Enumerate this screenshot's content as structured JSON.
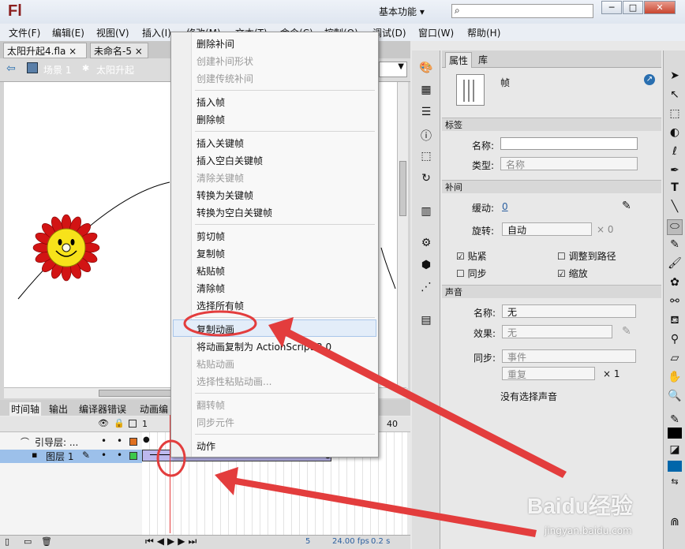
{
  "app": {
    "logo": "Fl",
    "workspace": "基本功能 ▾",
    "search_placeholder": "⌕"
  },
  "menubar": [
    "文件(F)",
    "编辑(E)",
    "视图(V)",
    "插入(I)",
    "修改(M)",
    "文本(T)",
    "命令(C)",
    "控制(O)",
    "调试(D)",
    "窗口(W)",
    "帮助(H)"
  ],
  "doc_tabs": [
    "太阳升起4.fla ×",
    "未命名-5 ×"
  ],
  "breadcrumb": {
    "scene": "场景 1",
    "symbol": "太阳升起"
  },
  "timeline": {
    "tabs": [
      "时间轴",
      "输出",
      "编译器错误",
      "动画编"
    ],
    "frame_marks": {
      "one": "1",
      "forty": "40"
    },
    "layers": [
      {
        "name": "引导层: ..."
      },
      {
        "name": "图层 1"
      }
    ],
    "status": {
      "frame": "5",
      "fps": "24.00 fps",
      "time": "0.2 s"
    }
  },
  "context_menu": {
    "items": [
      {
        "label": "删除补间",
        "disabled": false
      },
      {
        "label": "创建补间形状",
        "disabled": true
      },
      {
        "label": "创建传统补间",
        "disabled": true
      },
      {
        "label": "插入帧",
        "disabled": false
      },
      {
        "label": "删除帧",
        "disabled": false
      },
      {
        "label": "插入关键帧",
        "disabled": false
      },
      {
        "label": "插入空白关键帧",
        "disabled": false
      },
      {
        "label": "清除关键帧",
        "disabled": true
      },
      {
        "label": "转换为关键帧",
        "disabled": false
      },
      {
        "label": "转换为空白关键帧",
        "disabled": false
      },
      {
        "label": "剪切帧",
        "disabled": false
      },
      {
        "label": "复制帧",
        "disabled": false
      },
      {
        "label": "粘贴帧",
        "disabled": false
      },
      {
        "label": "清除帧",
        "disabled": false
      },
      {
        "label": "选择所有帧",
        "disabled": false
      },
      {
        "label": "复制动画",
        "disabled": false
      },
      {
        "label": "将动画复制为 ActionScript 3.0",
        "disabled": false
      },
      {
        "label": "粘贴动画",
        "disabled": true
      },
      {
        "label": "选择性粘贴动画...",
        "disabled": true
      },
      {
        "label": "翻转帧",
        "disabled": true
      },
      {
        "label": "同步元件",
        "disabled": true
      },
      {
        "label": "动作",
        "disabled": false
      }
    ]
  },
  "properties": {
    "tabs": [
      "属性",
      "库"
    ],
    "type_label": "帧",
    "sections": {
      "label": "标签",
      "tween": "补间",
      "sound": "声音"
    },
    "name_label": "名称:",
    "type_field_label": "类型:",
    "type_value": "名称",
    "ease_label": "缓动:",
    "ease_value": "0",
    "rotate_label": "旋转:",
    "rotate_value": "自动",
    "rotate_times": "× 0",
    "checks": [
      {
        "label": "贴紧",
        "checked": true
      },
      {
        "label": "调整到路径",
        "checked": false
      },
      {
        "label": "同步",
        "checked": false
      },
      {
        "label": "缩放",
        "checked": true
      }
    ],
    "sound_name_label": "名称:",
    "sound_name_value": "无",
    "effect_label": "效果:",
    "effect_value": "无",
    "sync_label": "同步:",
    "sync_value": "事件",
    "repeat_value": "重复",
    "repeat_times": "× 1",
    "no_sound": "没有选择声音"
  },
  "watermark": {
    "brand": "Baidu经验",
    "url": "jingyan.baidu.com"
  },
  "colors": {
    "annotation": "#e33d3d",
    "stage_bg": "#ffffff",
    "stroke": "#000000",
    "fill": "#0066aa"
  }
}
